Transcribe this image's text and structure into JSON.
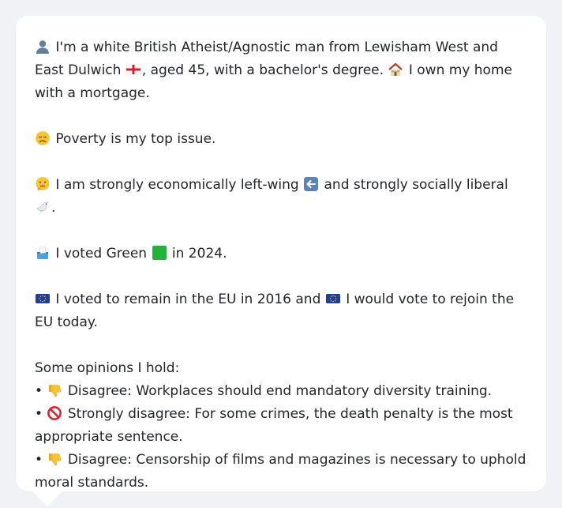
{
  "profile": {
    "intro_1": "I'm a white British Atheist/Agnostic man from Lewisham West and East Dulwich",
    "intro_2": ", aged 45, with a bachelor's degree.",
    "intro_3": "I own my home with a mortgage.",
    "top_issue": "Poverty is my top issue.",
    "ideology_1": "I am strongly economically left-wing",
    "ideology_2": "and strongly socially liberal",
    "ideology_3": ".",
    "vote_2024": "I voted Green",
    "vote_2024_end": "in 2024.",
    "eu_1": "I voted to remain in the EU in 2016 and",
    "eu_2": "I would vote to rejoin the EU today."
  },
  "opinions": {
    "heading": "Some opinions I hold:",
    "items": [
      {
        "bullet": "•",
        "icon": "thumbs-down-icon",
        "text": "Disagree: Workplaces should end mandatory diversity training."
      },
      {
        "bullet": "•",
        "icon": "prohibited-icon",
        "text": "Strongly disagree: For some crimes, the death penalty is the most appropriate sentence."
      },
      {
        "bullet": "•",
        "icon": "thumbs-down-icon",
        "text": "Disagree: Censorship of films and magazines is necessary to uphold moral standards."
      }
    ]
  },
  "icons": {
    "person": "person-silhouette-icon",
    "england_flag": "england-flag-icon",
    "house": "house-icon",
    "sad_face": "disappointed-face-icon",
    "thinking_face": "thinking-face-icon",
    "left_arrow": "left-arrow-icon",
    "dove": "dove-icon",
    "ballot": "ballot-box-icon",
    "green_square": "green-square-icon",
    "eu_flag": "eu-flag-icon"
  },
  "colors": {
    "background": "#f1f2f6",
    "card": "#ffffff",
    "text": "#23252b",
    "green_party": "#22b33a",
    "eu_blue": "#1f3f9b"
  }
}
